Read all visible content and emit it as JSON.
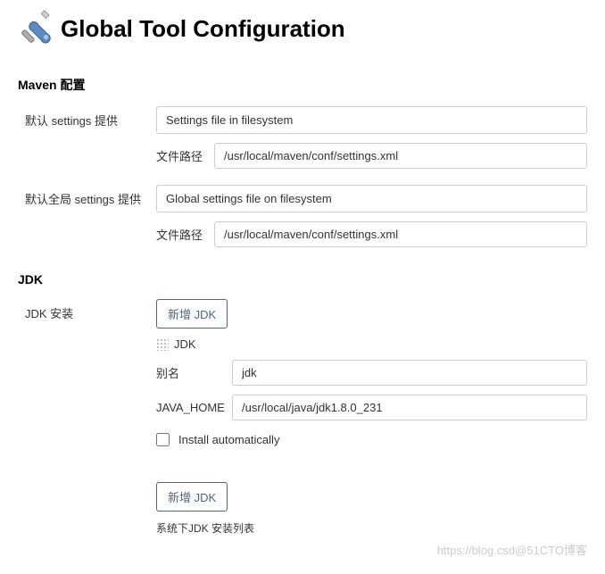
{
  "header": {
    "title": "Global Tool Configuration"
  },
  "maven": {
    "section_title": "Maven 配置",
    "default_settings": {
      "label": "默认 settings 提供",
      "select_value": "Settings file in filesystem",
      "path_label": "文件路径",
      "path_value": "/usr/local/maven/conf/settings.xml"
    },
    "global_settings": {
      "label": "默认全局 settings 提供",
      "select_value": "Global settings file on filesystem",
      "path_label": "文件路径",
      "path_value": "/usr/local/maven/conf/settings.xml"
    }
  },
  "jdk": {
    "section_title": "JDK",
    "install_label": "JDK 安装",
    "add_button": "新增 JDK",
    "entry": {
      "name": "JDK",
      "alias_label": "别名",
      "alias_value": "jdk",
      "java_home_label": "JAVA_HOME",
      "java_home_value": "/usr/local/java/jdk1.8.0_231",
      "install_auto_label": "Install automatically"
    },
    "add_button_bottom": "新增 JDK",
    "list_note": "系统下JDK 安装列表"
  },
  "watermark": "https://blog.csd@51CTO博客"
}
